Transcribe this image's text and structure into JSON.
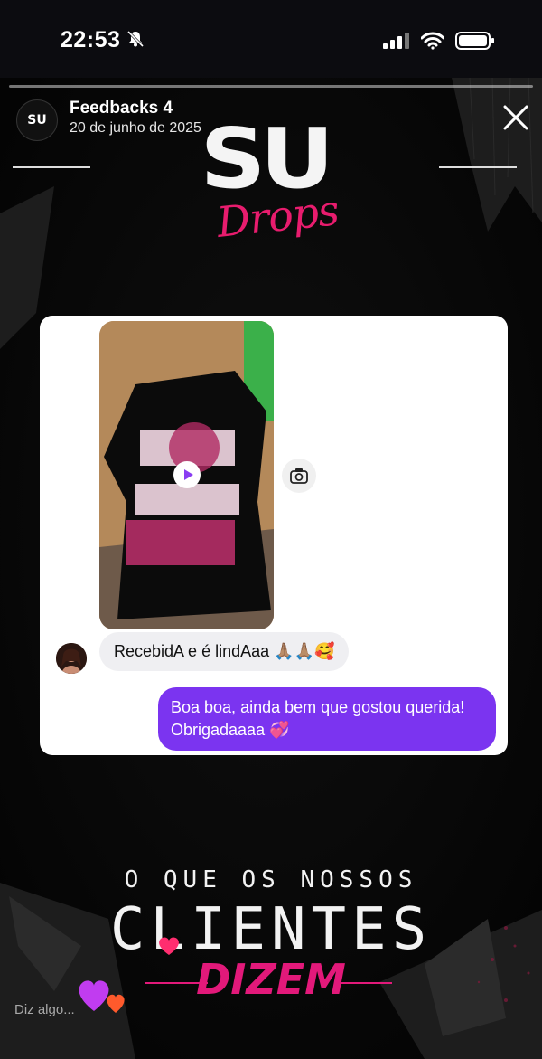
{
  "status_bar": {
    "time": "22:53"
  },
  "story": {
    "account_name": "Feedbacks 4",
    "date": "20 de junho de 2025",
    "avatar_text": "SU",
    "brand": {
      "main": "SU",
      "sub": "Drops"
    },
    "reply_placeholder": "Diz algo..."
  },
  "chat": {
    "incoming_message": "RecebidA e é lindAaa 🙏🏽🙏🏽🥰",
    "outgoing_message": "Boa boa, ainda bem que gostou querida! Obrigadaaaa 💞"
  },
  "headline": {
    "line1": "O QUE OS NOSSOS",
    "line2": "CLIENTES",
    "line3": "DIZEM"
  },
  "colors": {
    "accent_pink": "#e2197a",
    "bubble_purple": "#7b34f0"
  }
}
